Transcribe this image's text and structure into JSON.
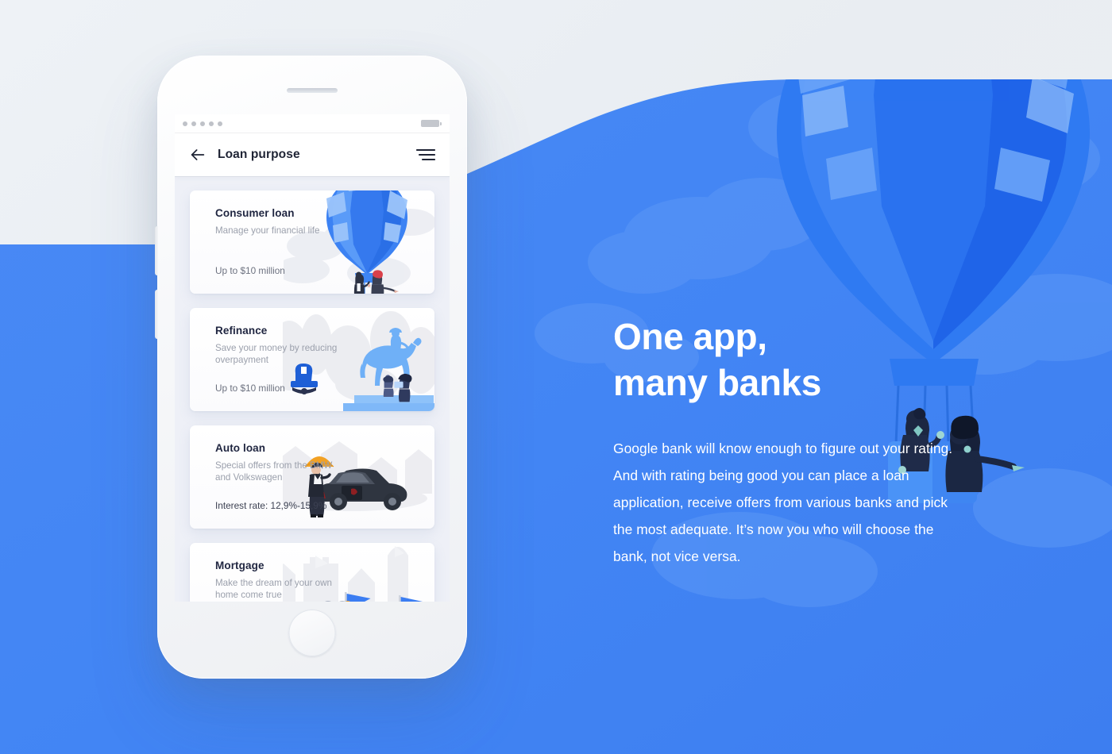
{
  "colors": {
    "brand_blue": "#4285f4",
    "deep_blue": "#1b5fe0",
    "light_bg": "#edf1f5",
    "screen_bg": "#eef0f7",
    "card_bg": "#ffffff",
    "title_text": "#1f2540",
    "muted_text": "#9ba0ac",
    "accent_orange": "#f2a124"
  },
  "phone": {
    "status_bar": {
      "signal_icon": "signal-dots-icon",
      "signal_dots": 5,
      "battery_icon": "battery-icon"
    },
    "app_bar": {
      "back_icon": "back-arrow-icon",
      "title": "Loan purpose",
      "menu_icon": "filter-lines-icon"
    },
    "cards": [
      {
        "title": "Consumer loan",
        "subtitle": "Manage your financial life",
        "meta": "Up to $10 million",
        "art": "hot-air-balloon-illustration"
      },
      {
        "title": "Refinance",
        "subtitle": "Save your money by reducing overpayment",
        "meta": "Up to $10 million",
        "art": "equestrian-statue-illustration"
      },
      {
        "title": "Auto loan",
        "subtitle": "Special offers from the BMW and Volkswagen",
        "meta": "Interest rate: 12,9%-15,9%",
        "art": "car-with-chauffeur-illustration"
      },
      {
        "title": "Mortgage",
        "subtitle": "Make the dream of your own home come true",
        "meta": "",
        "art": "castle-knights-illustration"
      }
    ]
  },
  "hero": {
    "headline": "One app,\nmany banks",
    "paragraph": "Google bank will know enough to figure out your rating. And with rating being good you can place a loan application, receive offers from various banks and pick the most adequate. It’s now you who will choose the bank, not vice versa.",
    "illustration": "hot-air-balloon-with-two-people-illustration"
  }
}
